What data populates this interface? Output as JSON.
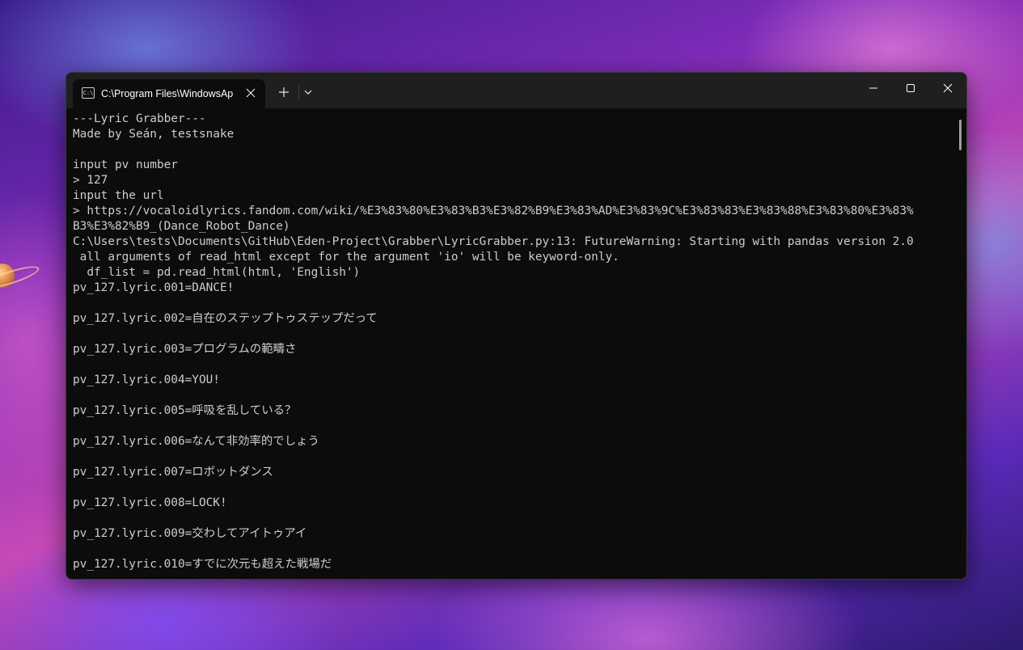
{
  "window": {
    "tab_title": "C:\\Program Files\\WindowsAp",
    "tab_icon_glyph": "C:\\",
    "controls": [
      "minimize",
      "maximize",
      "close"
    ]
  },
  "icons": {
    "tab_icon": "terminal-icon",
    "tab_close": "close-icon",
    "new_tab": "plus-icon",
    "dropdown": "chevron-down-icon",
    "minimize": "minimize-icon",
    "maximize": "maximize-icon",
    "close": "close-icon"
  },
  "colors": {
    "terminal_bg": "#0c0c0c",
    "terminal_text": "#cccccc",
    "titlebar_bg": "#1f1f1f"
  },
  "terminal": {
    "lines": [
      "---Lyric Grabber---",
      "Made by Seán, testsnake",
      "",
      "input pv number",
      "> 127",
      "input the url",
      "> https://vocaloidlyrics.fandom.com/wiki/%E3%83%80%E3%83%B3%E3%82%B9%E3%83%AD%E3%83%9C%E3%83%83%E3%83%88%E3%83%80%E3%83%",
      "B3%E3%82%B9_(Dance_Robot_Dance)",
      "C:\\Users\\tests\\Documents\\GitHub\\Eden-Project\\Grabber\\LyricGrabber.py:13: FutureWarning: Starting with pandas version 2.0",
      " all arguments of read_html except for the argument 'io' will be keyword-only.",
      "  df_list = pd.read_html(html, 'English')",
      "pv_127.lyric.001=DANCE!",
      "",
      "pv_127.lyric.002=自在のステップトゥステップだって",
      "",
      "pv_127.lyric.003=プログラムの範疇さ",
      "",
      "pv_127.lyric.004=YOU!",
      "",
      "pv_127.lyric.005=呼吸を乱している？",
      "",
      "pv_127.lyric.006=なんて非効率的でしょう",
      "",
      "pv_127.lyric.007=ロボットダンス",
      "",
      "pv_127.lyric.008=LOCK!",
      "",
      "pv_127.lyric.009=交わしてアイトゥアイ",
      "",
      "pv_127.lyric.010=すでに次元も超えた戦場だ"
    ]
  }
}
